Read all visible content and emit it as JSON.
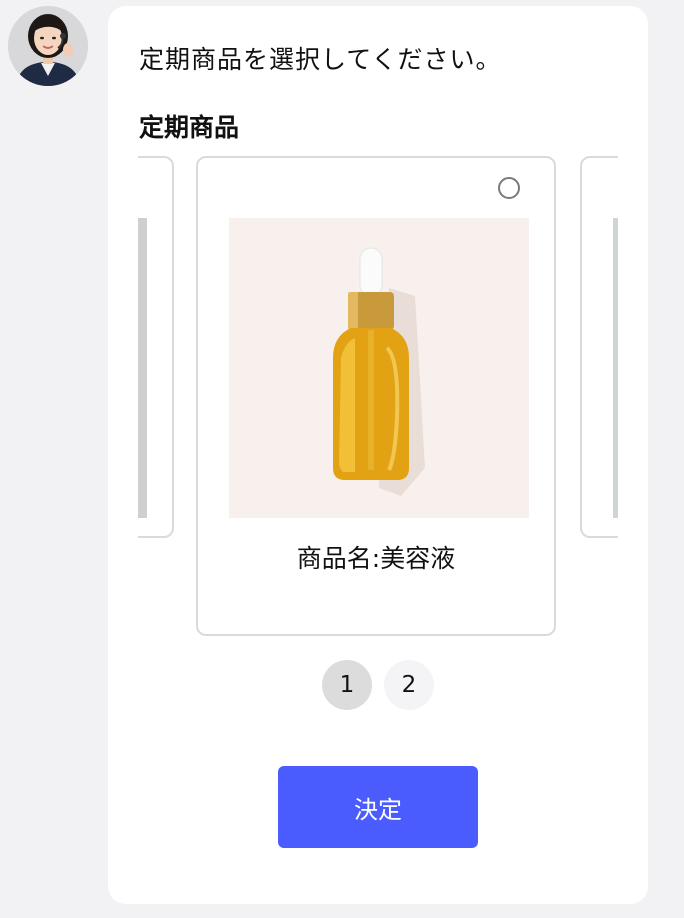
{
  "agent": {
    "avatar_icon": "operator-avatar-icon"
  },
  "message": {
    "prompt": "定期商品を選択してください。",
    "section_title": "定期商品"
  },
  "products": {
    "current": {
      "name": "商品名:美容液",
      "image_icon": "serum-bottle-image",
      "selected": false
    }
  },
  "pager": {
    "pages": [
      "1",
      "2"
    ],
    "current_page": "1"
  },
  "submit": {
    "label": "決定"
  },
  "colors": {
    "accent": "#4b5cff",
    "page_background": "#f2f2f4",
    "card_border": "#dadada"
  }
}
